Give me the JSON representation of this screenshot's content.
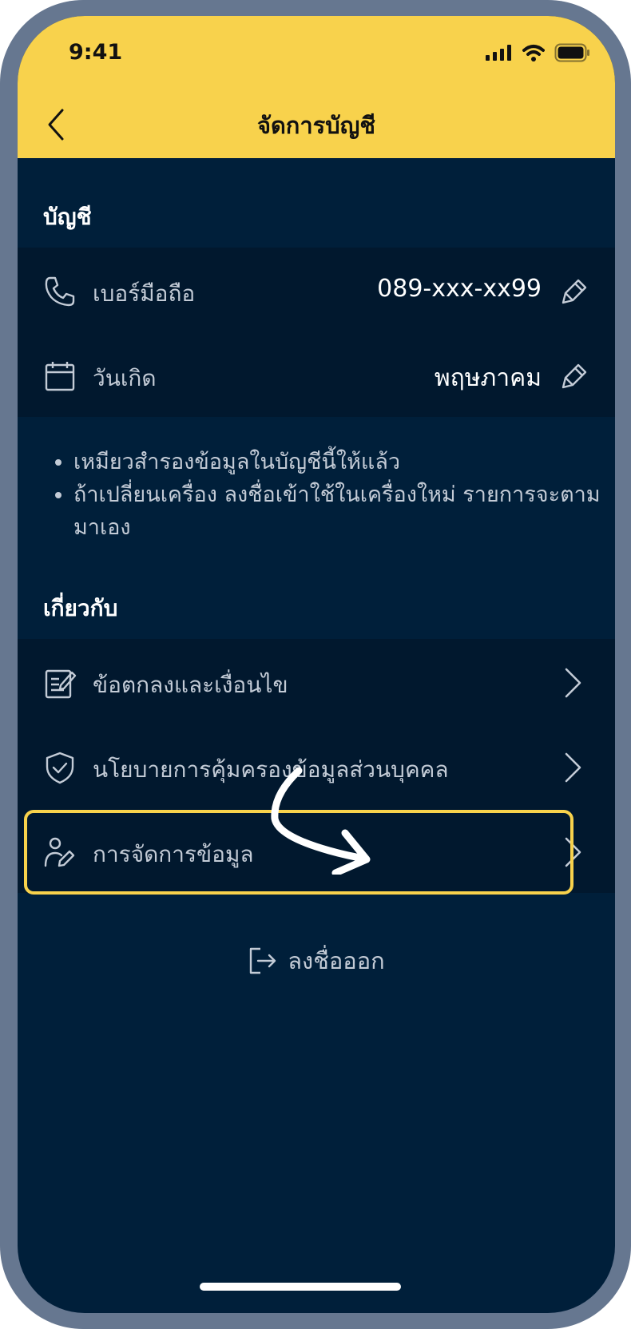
{
  "status_bar": {
    "time": "9:41"
  },
  "nav": {
    "title": "จัดการบัญชี"
  },
  "account_section": {
    "title": "บัญชี",
    "rows": [
      {
        "label": "เบอร์มือถือ",
        "value": "089-xxx-xx99"
      },
      {
        "label": "วันเกิด",
        "value": "พฤษภาคม"
      }
    ],
    "notes": [
      "เหมียวสำรองข้อมูลในบัญชีนี้ให้แล้ว",
      "ถ้าเปลี่ยนเครื่อง ลงชื่อเข้าใช้ในเครื่องใหม่ รายการจะตามมาเอง"
    ]
  },
  "about_section": {
    "title": "เกี่ยวกับ",
    "rows": [
      {
        "label": "ข้อตกลงและเงื่อนไข",
        "icon": "document-edit-icon"
      },
      {
        "label": "นโยบายการคุ้มครองข้อมูลส่วนบุคคล",
        "icon": "shield-check-icon"
      },
      {
        "label": "การจัดการข้อมูล",
        "icon": "user-edit-icon"
      }
    ]
  },
  "logout": {
    "label": "ลงชื่อออก"
  },
  "colors": {
    "header": "#f8d24c",
    "background": "#001f3a",
    "card": "#01182e",
    "highlight": "#f8d24c"
  }
}
